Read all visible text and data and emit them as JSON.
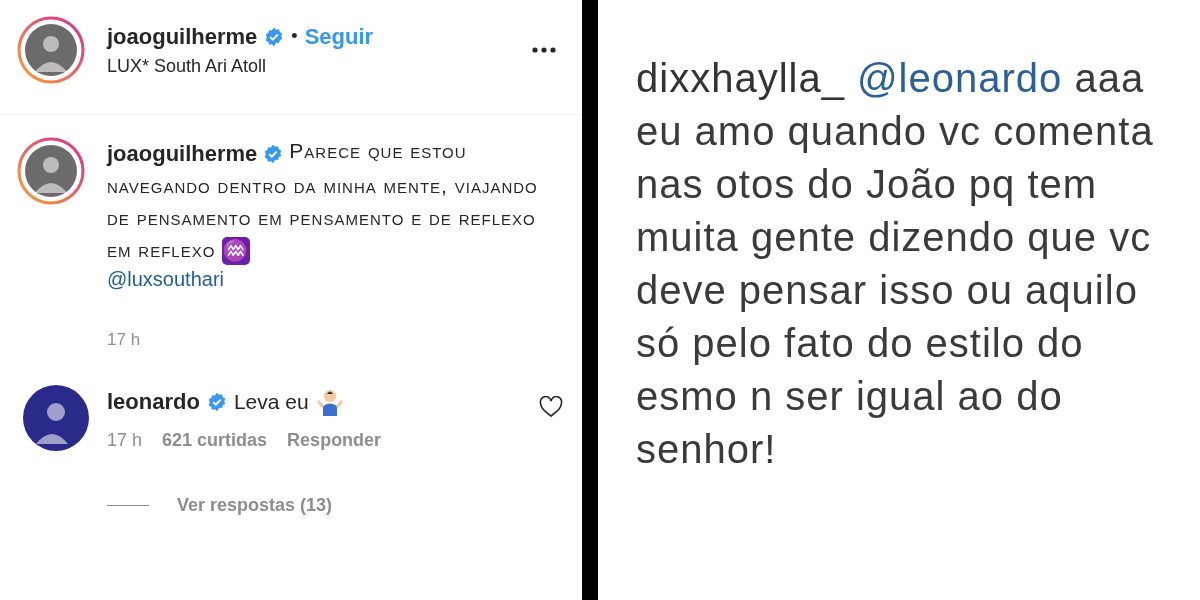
{
  "post": {
    "header": {
      "username": "joaoguilherme",
      "verified": true,
      "separator": "•",
      "follow": "Seguir",
      "location": "LUX* South Ari Atoll"
    },
    "caption": {
      "username": "joaoguilherme",
      "verified": true,
      "text": "Parece que estou navegando dentro da minha mente, viajando de pensamento em pensamento e de reflexo em reflexo",
      "symbol": "♒",
      "mention": "@luxsouthari",
      "time": "17 h"
    },
    "comments": [
      {
        "username": "leonardo",
        "verified": true,
        "text": "Leva eu",
        "time": "17 h",
        "likes": "621 curtidas",
        "reply": "Responder",
        "liked": false,
        "view_replies": "Ver respostas (13)"
      }
    ]
  },
  "zoomed_comment": {
    "username": "dixxhaylla_",
    "mention": "@leonardo",
    "text": "aaa eu amo quando vc comenta nas otos do João pq tem muita gente dizendo que vc deve pensar isso ou aquilo só pelo fato do estilo do esmo n ser igual ao do senhor!"
  }
}
